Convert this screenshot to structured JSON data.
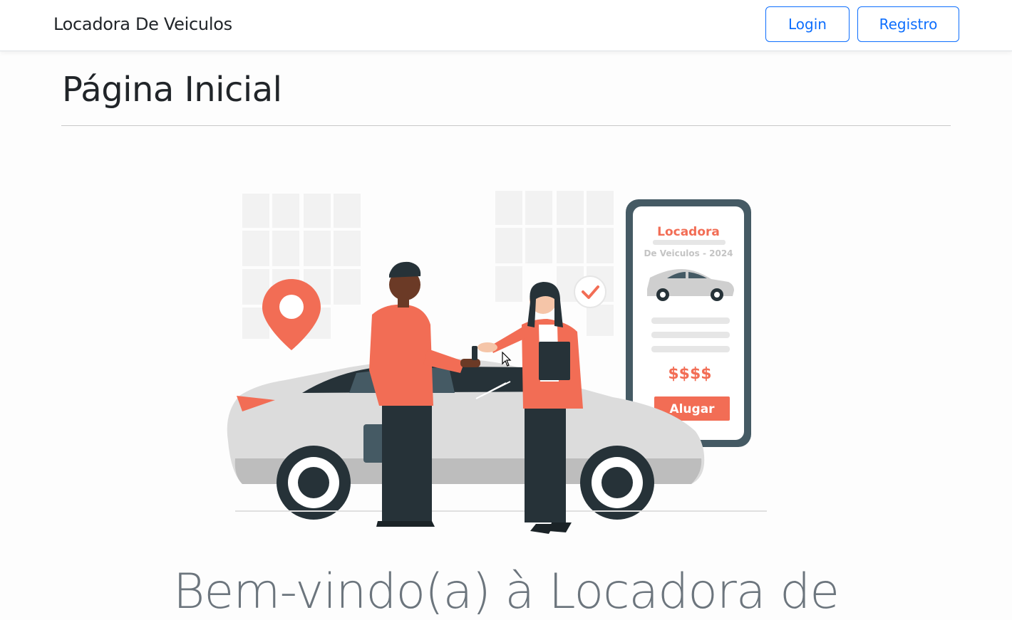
{
  "navbar": {
    "brand": "Locadora De Veiculos",
    "login_label": "Login",
    "register_label": "Registro"
  },
  "main": {
    "title": "Página Inicial",
    "welcome": "Bem-vindo(a) à Locadora de"
  },
  "illustration": {
    "phone_title": "Locadora",
    "phone_subtitle": "De Veiculos - 2024",
    "phone_price": "$$$$",
    "phone_button": "Alugar",
    "icons": [
      "location-pin-icon",
      "checkmark-icon",
      "car-icon"
    ]
  },
  "colors": {
    "accent": "#0d6efd",
    "illustration_orange": "#f26d55",
    "illustration_dark": "#263238",
    "text_muted": "#6c757d"
  }
}
